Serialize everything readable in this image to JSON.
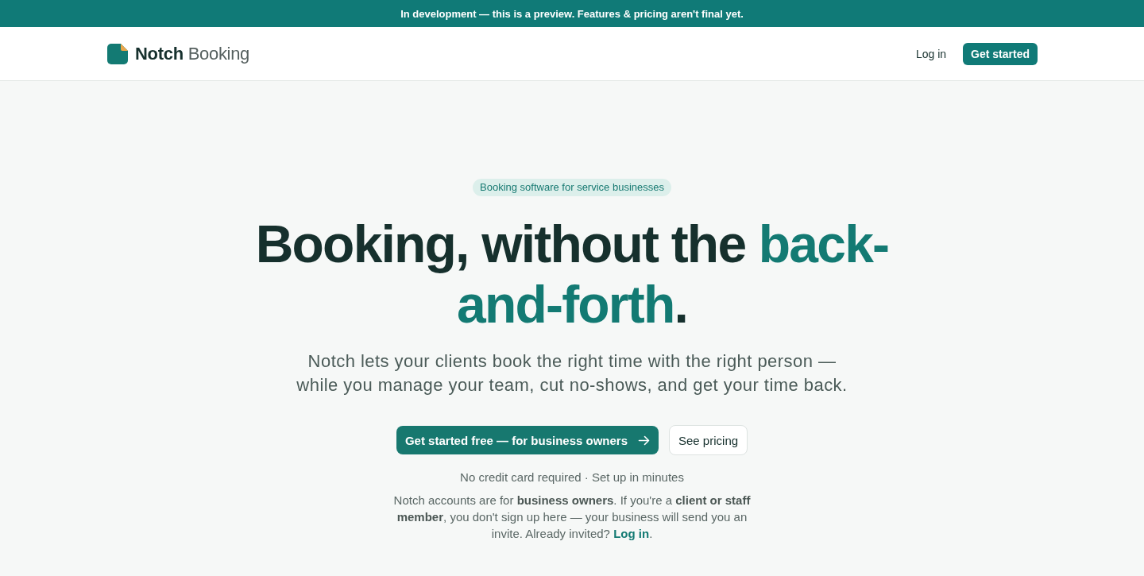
{
  "banner": {
    "text": "In development — this is a preview. Features & pricing aren't final yet."
  },
  "nav": {
    "brand": {
      "name": "Notch",
      "suffix": "Booking"
    },
    "links": [
      {
        "label": "Log in",
        "kind": "link"
      },
      {
        "label": "Get started",
        "kind": "primary"
      }
    ]
  },
  "hero": {
    "badge": "Booking software for service businesses",
    "headline": [
      {
        "text": "Booking, without the ",
        "accent": false
      },
      {
        "text": "back-and-forth",
        "accent": true
      },
      {
        "text": ".",
        "accent": false
      }
    ],
    "subtitle": "Notch lets your clients book the right time with the right person — while you manage your team, cut no-shows, and get your time back.",
    "actions": [
      {
        "label": "Get started free — for business owners",
        "kind": "primary",
        "arrow": true
      },
      {
        "label": "See pricing",
        "kind": "secondary",
        "arrow": false
      }
    ],
    "fine_print": "No credit card required · Set up in minutes",
    "note": {
      "text": "Notch accounts are for **business owners**. If you're a **client or staff member**, you don't sign up here — your business will send you an invite. Already invited? ",
      "link": "Log in",
      "end": "."
    }
  }
}
